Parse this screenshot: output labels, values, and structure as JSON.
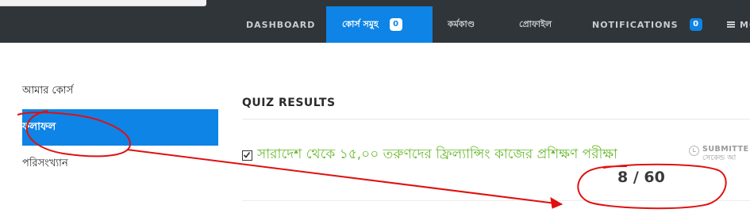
{
  "nav": {
    "items": [
      {
        "label": "DASHBOARD"
      },
      {
        "label": "কোর্স সমুহ",
        "badge": "0",
        "active": true
      },
      {
        "label": "কর্মকাণ্ড"
      },
      {
        "label": "প্রোফাইল"
      },
      {
        "label": "NOTIFICATIONS",
        "badge": "0"
      },
      {
        "label": "MO"
      }
    ]
  },
  "sidebar": {
    "items": [
      {
        "label": "আমার কোর্স"
      },
      {
        "label": "ফলাফল",
        "active": true
      },
      {
        "label": "পরিসংখ্যান"
      }
    ]
  },
  "main": {
    "heading": "QUIZ RESULTS",
    "quiz": {
      "title": "সারাদেশ থেকে ১৫,০০ তরুণদের ফ্রিল্যান্সিং কাজের প্রশিক্ষণ পরীক্ষা",
      "status": "SUBMITTE",
      "status_sub": "সেকেন্ড আ",
      "score": "8 / 60"
    }
  },
  "colors": {
    "topbar": "#303539",
    "accent": "#0d84e6",
    "quiz_link": "#6ab92d",
    "annotation": "#e01010"
  }
}
